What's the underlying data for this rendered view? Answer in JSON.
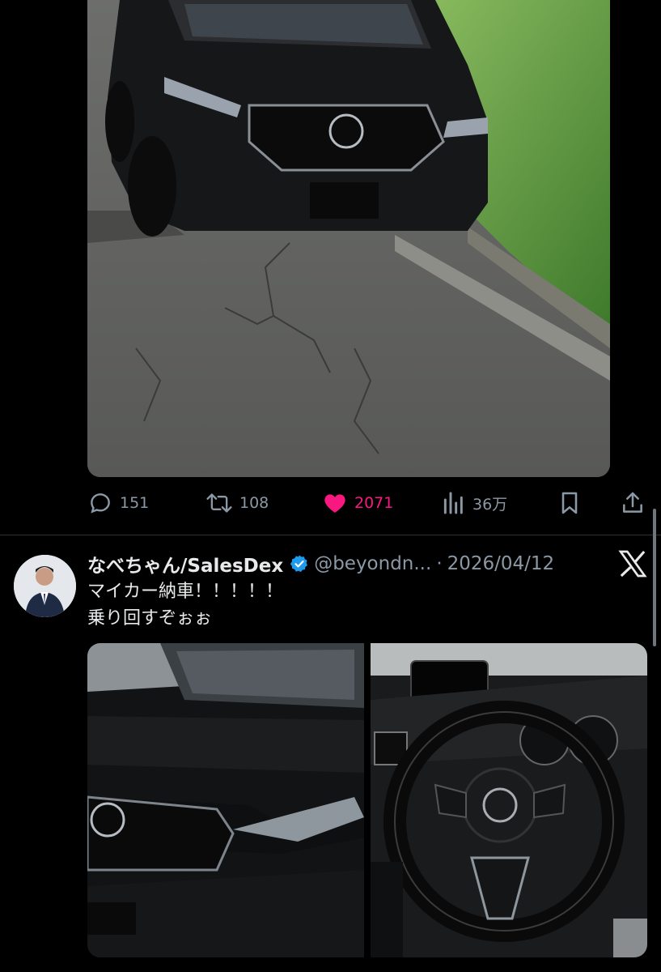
{
  "tweet1": {
    "photo_alt": "black Mazda SUV parked on cracked asphalt next to grass",
    "actions": {
      "replies": "151",
      "retweets": "108",
      "likes": "2071",
      "views": "36万"
    },
    "colors": {
      "like": "#f91880",
      "muted": "#8b98a5"
    }
  },
  "tweet2": {
    "display_name": "なべちゃん/SalesDex",
    "handle": "@beyondn...",
    "separator": "·",
    "date": "2026/04/12",
    "text_line1": "マイカー納車！！！！！",
    "text_line2": "乗り回すぞぉぉ",
    "icons": [
      "verified-badge-icon",
      "x-logo-icon"
    ],
    "colors": {
      "verified": "#1d9bf0"
    }
  }
}
